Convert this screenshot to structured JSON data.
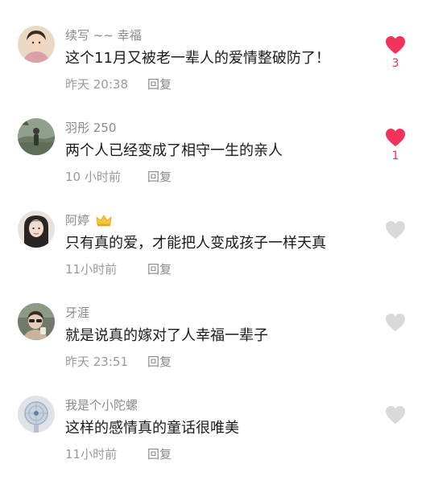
{
  "colors": {
    "liked": "#f2345c",
    "unliked": "#d9d9d9",
    "count": "#ec2f53"
  },
  "comments": [
    {
      "username": "续写 ~~ 幸福",
      "text": "这个11月又被老一辈人的爱情整破防了！",
      "time": "昨天 20:38",
      "reply": "回复",
      "liked": true,
      "likes": "3",
      "badge": ""
    },
    {
      "username": "羽彤 250",
      "text": "两个人已经变成了相守一生的亲人",
      "time": "10 小时前",
      "reply": "回复",
      "liked": true,
      "likes": "1",
      "badge": ""
    },
    {
      "username": "阿婷",
      "text": "只有真的爱，才能把人变成孩子一样天真",
      "time": "11小时前",
      "reply": "回复",
      "liked": false,
      "likes": "",
      "badge": "crown-icon"
    },
    {
      "username": "牙涯",
      "text": "就是说真的嫁对了人幸福一辈子",
      "time": "昨天 23:51",
      "reply": "回复",
      "liked": false,
      "likes": "",
      "badge": ""
    },
    {
      "username": "我是个小陀螺",
      "text": "这样的感情真的童话很唯美",
      "time": "11小时前",
      "reply": "回复",
      "liked": false,
      "likes": "",
      "badge": ""
    }
  ]
}
